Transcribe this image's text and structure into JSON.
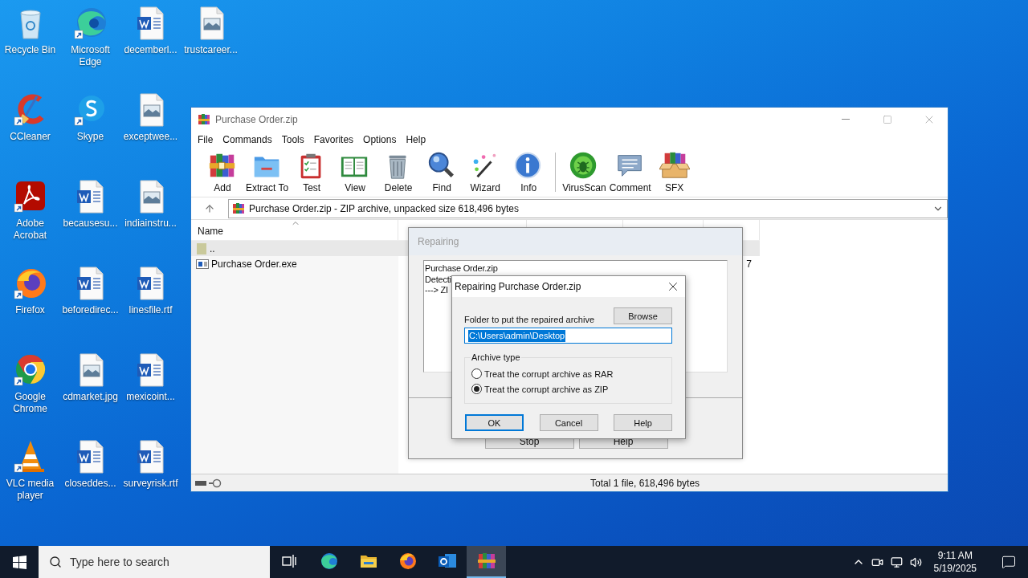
{
  "desktop_icons": [
    {
      "label": "Recycle Bin"
    },
    {
      "label": "CCleaner"
    },
    {
      "label": "Adobe Acrobat"
    },
    {
      "label": "Firefox"
    },
    {
      "label": "Google Chrome"
    },
    {
      "label": "VLC media player"
    },
    {
      "label": "Microsoft Edge"
    },
    {
      "label": "Skype"
    },
    {
      "label": "becausesu..."
    },
    {
      "label": "beforedirec..."
    },
    {
      "label": "cdmarket.jpg"
    },
    {
      "label": "closeddes..."
    },
    {
      "label": "decemberl..."
    },
    {
      "label": "exceptwee..."
    },
    {
      "label": "indiainstru..."
    },
    {
      "label": "linesfile.rtf"
    },
    {
      "label": "mexicoint..."
    },
    {
      "label": "surveyrisk.rtf"
    },
    {
      "label": "trustcareer..."
    }
  ],
  "archive_window": {
    "title": "Purchase Order.zip",
    "menu": [
      "File",
      "Commands",
      "Tools",
      "Favorites",
      "Options",
      "Help"
    ],
    "toolbar_groups": [
      {
        "buttons": [
          {
            "label": "Add"
          },
          {
            "label": "Extract To"
          },
          {
            "label": "Test"
          },
          {
            "label": "View"
          },
          {
            "label": "Delete"
          },
          {
            "label": "Find"
          },
          {
            "label": "Wizard"
          },
          {
            "label": "Info"
          }
        ]
      },
      {
        "buttons": [
          {
            "label": "VirusScan"
          },
          {
            "label": "Comment"
          },
          {
            "label": "SFX"
          }
        ]
      }
    ],
    "address": "Purchase Order.zip - ZIP archive, unpacked size 618,496 bytes",
    "columns": [
      "Name"
    ],
    "files": [
      {
        "name": "..",
        "selected": true
      },
      {
        "name": "Purchase Order.exe",
        "selected": false,
        "column_5": "7"
      }
    ],
    "status": "Total 1 file, 618,496 bytes"
  },
  "repairing_window": {
    "title": "Repairing",
    "log": [
      "Purchase Order.zip",
      "Detecti",
      "---> ZI"
    ],
    "buttons": [
      "Stop",
      "Help"
    ]
  },
  "repair_dialog": {
    "title": "Repairing Purchase Order.zip",
    "folder_label": "Folder to put the repaired archive",
    "browse": "Browse",
    "folder_value": "C:\\Users\\admin\\Desktop",
    "group_label": "Archive type",
    "options": [
      {
        "label": "Treat the corrupt archive as RAR",
        "selected": false
      },
      {
        "label": "Treat the corrupt archive as ZIP",
        "selected": true
      }
    ],
    "buttons": [
      {
        "label": "OK",
        "default": true
      },
      {
        "label": "Cancel",
        "default": false
      },
      {
        "label": "Help",
        "default": false
      }
    ]
  },
  "taskbar": {
    "search": {
      "placeholder": "Type here to search"
    },
    "apps": [
      {
        "selected": false
      },
      {
        "selected": false
      },
      {
        "selected": false
      },
      {
        "selected": false
      },
      {
        "selected": true
      }
    ],
    "time": "9:11 AM",
    "date": "5/19/2025"
  }
}
